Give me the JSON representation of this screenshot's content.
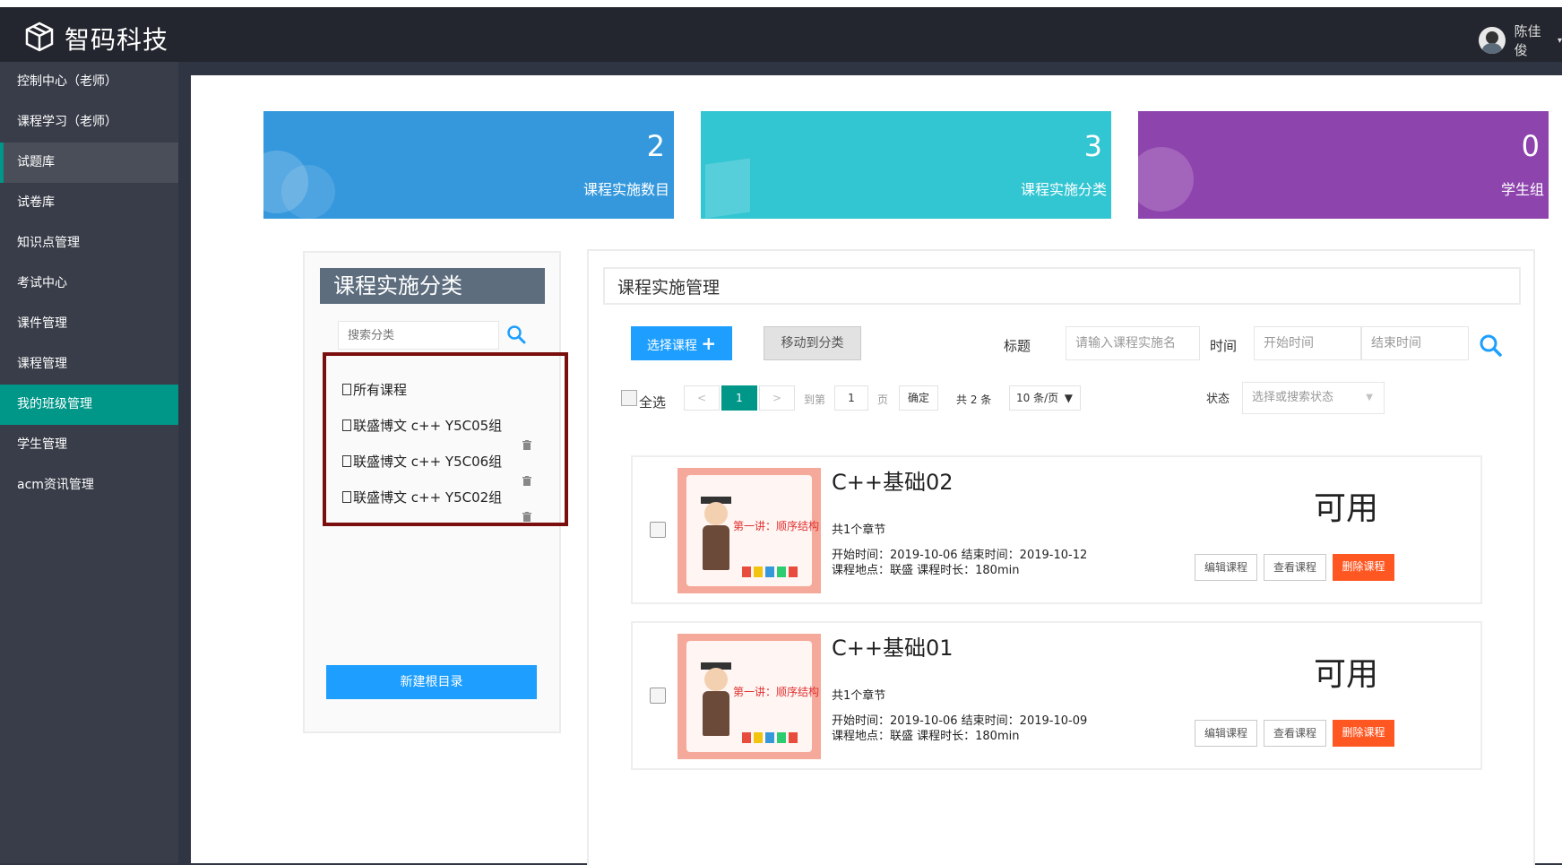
{
  "header": {
    "brand": "智码科技",
    "user_name": "陈佳俊"
  },
  "sidebar": {
    "items": [
      {
        "label": "控制中心（老师）"
      },
      {
        "label": "课程学习（老师）"
      },
      {
        "label": "试题库"
      },
      {
        "label": "试卷库"
      },
      {
        "label": "知识点管理"
      },
      {
        "label": "考试中心"
      },
      {
        "label": "课件管理"
      },
      {
        "label": "课程管理"
      },
      {
        "label": "我的班级管理"
      },
      {
        "label": "学生管理"
      },
      {
        "label": "acm资讯管理"
      }
    ],
    "hover_index": 2,
    "active_index": 8
  },
  "stats": [
    {
      "value": "2",
      "label": "课程实施数目",
      "color": "#3598dc"
    },
    {
      "value": "3",
      "label": "课程实施分类",
      "color": "#32c5d2"
    },
    {
      "value": "0",
      "label": "学生组",
      "color": "#8e44ad"
    }
  ],
  "category_panel": {
    "title": "课程实施分类",
    "search_placeholder": "搜索分类",
    "items": [
      {
        "label": "所有课程"
      },
      {
        "label": "联盛博文 c++ Y5C05组"
      },
      {
        "label": "联盛博文 c++ Y5C06组"
      },
      {
        "label": "联盛博文 c++ Y5C02组"
      }
    ],
    "new_root_label": "新建根目录"
  },
  "manage_panel": {
    "title": "课程实施管理",
    "select_course_label": "选择课程",
    "move_to_category_label": "移动到分类",
    "title_label": "标题",
    "title_placeholder": "请输入课程实施名",
    "time_label": "时间",
    "start_placeholder": "开始时间",
    "end_placeholder": "结束时间",
    "select_all_label": "全选",
    "pager": {
      "prev": "<",
      "current": "1",
      "next": ">",
      "goto_label": "到第",
      "page_input": "1",
      "page_unit": "页",
      "confirm": "确定",
      "total": "共 2 条",
      "page_size": "10 条/页"
    },
    "status_label": "状态",
    "status_placeholder": "选择或搜索状态"
  },
  "courses": [
    {
      "title": "C++基础02",
      "thumb_text": "第一讲：顺序结构",
      "chapters": "共1个章节",
      "time": "开始时间：2019-10-06 结束时间：2019-10-12",
      "location": "课程地点：联盛  课程时长：180min",
      "status": "可用",
      "edit": "编辑课程",
      "view": "查看课程",
      "delete": "删除课程"
    },
    {
      "title": "C++基础01",
      "thumb_text": "第一讲：顺序结构",
      "chapters": "共1个章节",
      "time": "开始时间：2019-10-06 结束时间：2019-10-09",
      "location": "课程地点：联盛  课程时长：180min",
      "status": "可用",
      "edit": "编辑课程",
      "view": "查看课程",
      "delete": "删除课程"
    }
  ]
}
